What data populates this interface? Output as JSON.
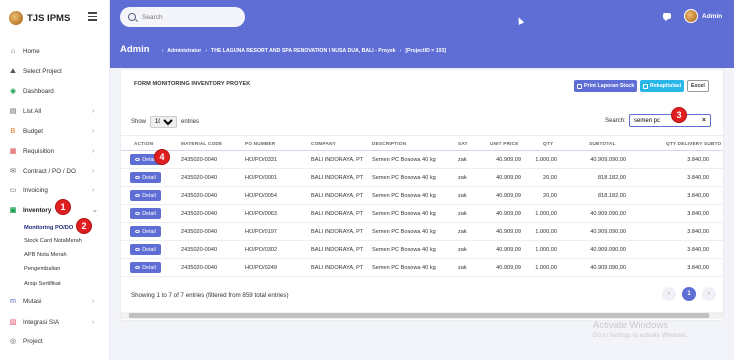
{
  "app": {
    "name": "TJS IPMS"
  },
  "sidebar": {
    "items": [
      {
        "label": "Home",
        "icon": "home-icon",
        "glyph": "⌂"
      },
      {
        "label": "Select Project",
        "icon": "project-icon",
        "glyph": "⛰"
      },
      {
        "label": "Dashboard",
        "icon": "dashboard-icon",
        "glyph": "◉"
      },
      {
        "label": "List All",
        "icon": "list-icon",
        "glyph": "▤"
      },
      {
        "label": "Budget",
        "icon": "budget-icon",
        "glyph": "B"
      },
      {
        "label": "Requisition",
        "icon": "requisition-icon",
        "glyph": "▦"
      },
      {
        "label": "Contract / PO / DO",
        "icon": "contract-icon",
        "glyph": "✉"
      },
      {
        "label": "Invoicing",
        "icon": "invoice-icon",
        "glyph": "▭"
      },
      {
        "label": "Inventory",
        "icon": "inventory-icon",
        "glyph": "▣"
      },
      {
        "label": "Mutasi",
        "icon": "mutasi-icon",
        "glyph": "m"
      },
      {
        "label": "Integrasi SIA",
        "icon": "integration-icon",
        "glyph": "▧"
      },
      {
        "label": "Project",
        "icon": "user-icon",
        "glyph": "◎"
      }
    ],
    "inventory_sub": [
      "Monitoring PO/DO",
      "Stock Card NotaMerah",
      "APB Nota Merah",
      "Pengembalian",
      "Arsip Sertifikat"
    ],
    "arrow": "›",
    "arrow_open": "⌄"
  },
  "header": {
    "search_placeholder": "Search",
    "user": "Admin",
    "page_title": "Admin",
    "breadcrumb": [
      "Administrator",
      "THE LAGUNA RESORT AND SPA RENOVATION I NUSA DUA, BALI - Proyek",
      "[ProjectID = 193]"
    ],
    "separator": "›"
  },
  "card": {
    "title": "FORM MONITORING INVENTORY PROYEK",
    "buttons": {
      "print": "Print Laporan Stock",
      "rekap": "Rekapitulasi",
      "excel": "Excel"
    }
  },
  "table_controls": {
    "show": "Show",
    "entries_value": "10",
    "entries": "entries",
    "search_label": "Search:",
    "search_value": "semen pc",
    "clear": "×"
  },
  "table": {
    "columns": [
      "ACTION",
      "MATERIAL CODE",
      "PO NUMBER",
      "COMPANY",
      "DESCRIPTION",
      "SAT",
      "UNIT PRICE",
      "QTY",
      "SUBTOTAL",
      "QTY DELIVERY",
      "SUBTO"
    ],
    "detail_label": "Detail",
    "rows": [
      [
        "2435020-0040",
        "HO/PO/0331",
        "BALI INDORAYA, PT",
        "Semen PC Bosowa 40 kg",
        "zak",
        "40.909,09",
        "1.000,00",
        "40.909.090,00",
        "3.840,00"
      ],
      [
        "2435020-0040",
        "HO/PO/0001",
        "BALI INDORAYA, PT",
        "Semen PC Bosowa 40 kg",
        "zak",
        "40.909,09",
        "20,00",
        "818.182,00",
        "3.840,00"
      ],
      [
        "2435020-0040",
        "HO/PO/0054",
        "BALI INDORAYA, PT",
        "Semen PC Bosowa 40 kg",
        "zak",
        "40.909,09",
        "20,00",
        "818.182,00",
        "3.840,00"
      ],
      [
        "2435020-0040",
        "HO/PO/0063",
        "BALI INDORAYA, PT",
        "Semen PC Bosowa 40 kg",
        "zak",
        "40.909,09",
        "1.000,00",
        "40.909.090,00",
        "3.840,00"
      ],
      [
        "2435020-0040",
        "HO/PO/0197",
        "BALI INDORAYA, PT",
        "Semen PC Bosowa 40 kg",
        "zak",
        "40.909,09",
        "1.000,00",
        "40.909.090,00",
        "3.840,00"
      ],
      [
        "2435020-0040",
        "HO/PO/0302",
        "BALI INDORAYA, PT",
        "Semen PC Bosowa 40 kg",
        "zak",
        "40.909,09",
        "1.000,00",
        "40.909.090,00",
        "3.840,00"
      ],
      [
        "2435020-0040",
        "HO/PO/0249",
        "BALI INDORAYA, PT",
        "Semen PC Bosowa 40 kg",
        "zak",
        "40.909,09",
        "1.000,00",
        "40.909.090,00",
        "3.840,00"
      ]
    ]
  },
  "footer": {
    "showing": "Showing 1 to 7 of 7 entries (filtered from 859 total entries)",
    "prev": "‹",
    "page": "1",
    "next": "›"
  },
  "annotations": [
    "1",
    "2",
    "3",
    "4"
  ],
  "watermark": {
    "line1": "Activate Windows",
    "line2": "Go to Settings to activate Windows."
  },
  "colors": {
    "primary": "#5f6ed4",
    "info": "#29b6e8",
    "badge": "#e02020",
    "content_bg": "#f3f4f9"
  }
}
